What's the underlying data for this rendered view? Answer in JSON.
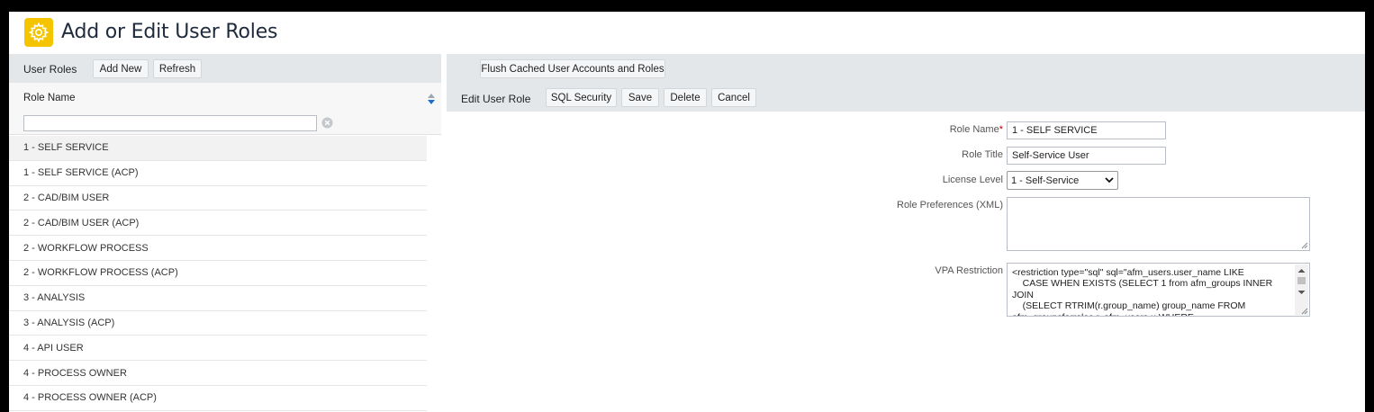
{
  "header": {
    "title": "Add or Edit User Roles",
    "icon": "gear-icon",
    "icon_color": "#f5c400"
  },
  "left_panel": {
    "label": "User Roles",
    "add_new_label": "Add New",
    "refresh_label": "Refresh",
    "column_header": "Role Name",
    "filter_value": "",
    "rows": [
      "1 - SELF SERVICE",
      "1 - SELF SERVICE (ACP)",
      "2 - CAD/BIM USER",
      "2 - CAD/BIM USER (ACP)",
      "2 - WORKFLOW PROCESS",
      "2 - WORKFLOW PROCESS (ACP)",
      "3 - ANALYSIS",
      "3 - ANALYSIS (ACP)",
      "4 - API USER",
      "4 - PROCESS OWNER",
      "4 - PROCESS OWNER (ACP)"
    ],
    "selected_index": 0
  },
  "right_panel": {
    "flush_label": "Flush Cached User Accounts and Roles",
    "section_label": "Edit User Role",
    "sql_security_label": "SQL Security",
    "save_label": "Save",
    "delete_label": "Delete",
    "cancel_label": "Cancel",
    "form": {
      "role_name_label": "Role Name",
      "required_marker": "*",
      "role_name_value": "1 - SELF SERVICE",
      "role_title_label": "Role Title",
      "role_title_value": "Self-Service User",
      "license_level_label": "License Level",
      "license_level_value": "1 - Self-Service",
      "role_preferences_label": "Role Preferences (XML)",
      "role_preferences_value": "",
      "vpa_label": "VPA Restriction",
      "vpa_value": "<restriction type=\"sql\" sql=\"afm_users.user_name LIKE\n    CASE WHEN EXISTS (SELECT 1 from afm_groups INNER JOIN\n    (SELECT RTRIM(r.group_name) group_name FROM\nafm_groupsforroles r, afm_users u WHERE"
    }
  },
  "colors": {
    "toolbar_bg": "#e4e7ea",
    "required_marker": "#c00000",
    "sort_up": "#9ea7b0",
    "sort_down": "#1a6fc9"
  }
}
